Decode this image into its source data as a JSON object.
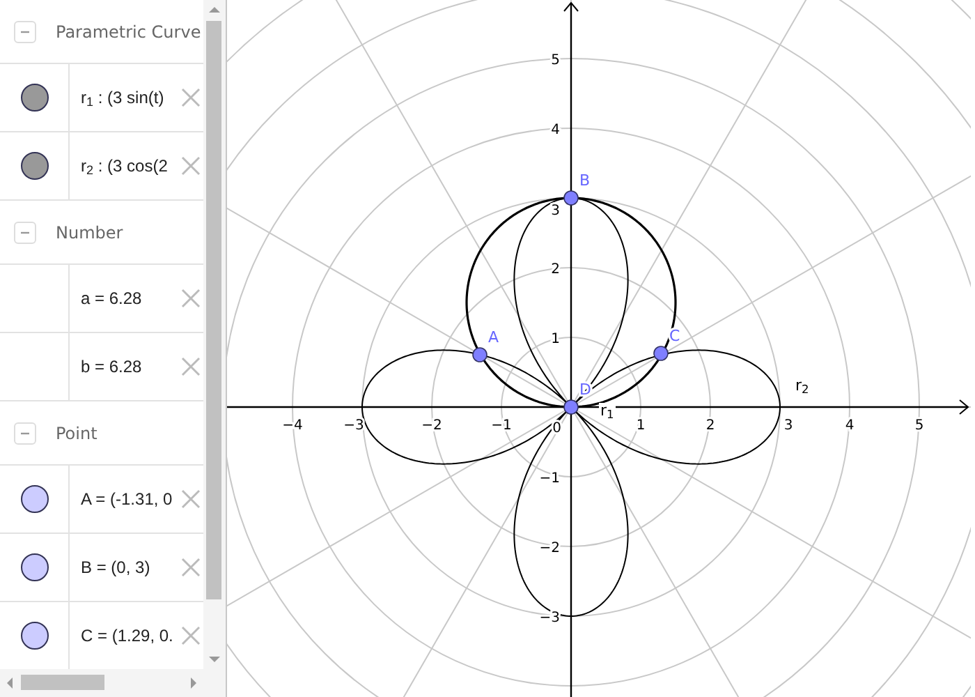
{
  "algebra": {
    "groups": [
      {
        "title": "Parametric Curve",
        "expanded": true,
        "items": [
          {
            "text": "r$_{1}$ : (3 sin(t)",
            "color": "#999999"
          },
          {
            "text": "r$_{2}$ : (3 cos(2",
            "color": "#999999"
          }
        ]
      },
      {
        "title": "Number",
        "expanded": true,
        "items": [
          {
            "text": "a = 6.28"
          },
          {
            "text": "b = 6.28"
          }
        ]
      },
      {
        "title": "Point",
        "expanded": true,
        "items": [
          {
            "text": "A = (-1.31, 0",
            "color": "#ccccff"
          },
          {
            "text": "B = (0, 3)",
            "color": "#ccccff"
          },
          {
            "text": "C = (1.29, 0.",
            "color": "#ccccff"
          }
        ]
      }
    ]
  },
  "graphics": {
    "x_ticks": [
      "−4",
      "−3",
      "−2",
      "−1",
      "1",
      "2",
      "3",
      "4",
      "5"
    ],
    "y_ticks": [
      "5",
      "4",
      "3",
      "2",
      "1",
      "−1",
      "−2",
      "−3"
    ],
    "origin_label": "0",
    "points": [
      {
        "label": "A"
      },
      {
        "label": "B"
      },
      {
        "label": "C"
      },
      {
        "label": "D"
      }
    ],
    "curve_labels": [
      "r$_{1}$",
      "r$_{2}$"
    ]
  }
}
